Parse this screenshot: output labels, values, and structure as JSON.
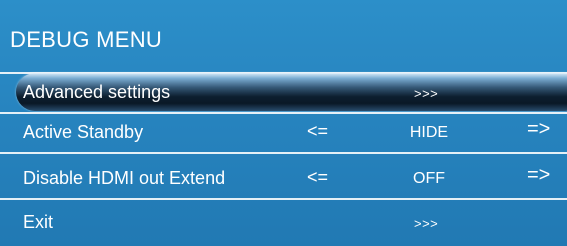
{
  "menu": {
    "title": "DEBUG MENU",
    "items": [
      {
        "label": "Advanced settings",
        "value": ">>>",
        "selected": true
      },
      {
        "label": "Active Standby",
        "left_arrow": "<=",
        "value": "HIDE",
        "right_arrow": "=>"
      },
      {
        "label": "Disable HDMI out Extend",
        "left_arrow": "<=",
        "value": "OFF",
        "right_arrow": "=>"
      },
      {
        "label": "Exit",
        "value": ">>>"
      }
    ]
  },
  "colors": {
    "panel_background": "#2784bf",
    "selection_highlight": "#0d1f30",
    "text": "#ffffff"
  }
}
